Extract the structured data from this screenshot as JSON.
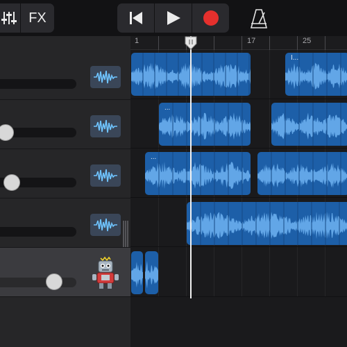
{
  "toolbar": {
    "mixer_icon": "mixer-sliders-icon",
    "fx_label": "FX",
    "rewind_icon": "skip-back-icon",
    "play_icon": "play-icon",
    "record_icon": "record-icon",
    "record_color": "#e5302d",
    "metronome_icon": "metronome-icon"
  },
  "ruler": {
    "bars": [
      "1",
      "9",
      "17",
      "25"
    ]
  },
  "colors": {
    "region": "#1d5fa8",
    "waveform": "#6fb3f2",
    "selected_track": "#3b3b3f"
  },
  "tracks": [
    {
      "name": "track-1",
      "volume": 0.0,
      "icon": "waveform-icon"
    },
    {
      "name": "track-2",
      "volume": 0.15,
      "icon": "waveform-icon"
    },
    {
      "name": "track-3",
      "volume": 0.22,
      "icon": "waveform-icon"
    },
    {
      "name": "track-4",
      "volume": 0.0,
      "icon": "waveform-icon"
    },
    {
      "name": "track-5",
      "volume": 0.75,
      "icon": "robot-icon",
      "selected": true
    }
  ],
  "regions": {
    "track1_b_title": "I...",
    "track2_a_title": "...",
    "track3_a_title": "..."
  }
}
